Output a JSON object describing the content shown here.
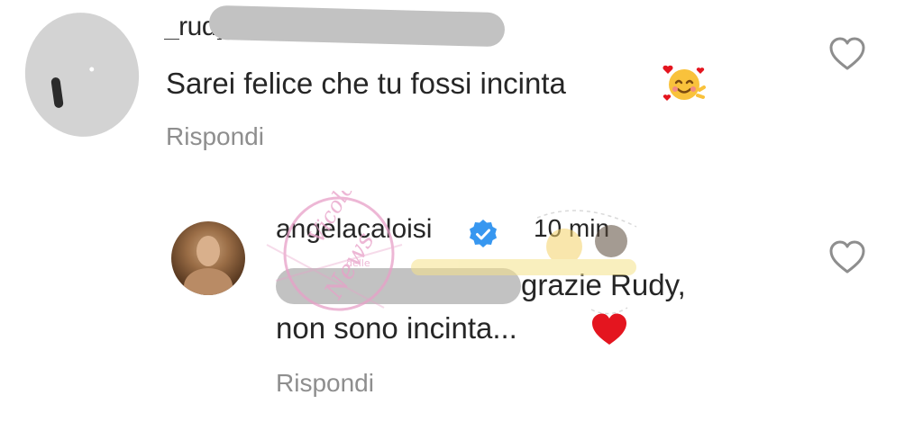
{
  "comments": [
    {
      "username": "_rudy_g",
      "text": "Sarei felice che tu fossi incinta",
      "emoji": "smiling-face-with-hearts",
      "reply_label": "Rispondi",
      "like_icon": "heart-outline-icon"
    },
    {
      "username": "angelacaloisi",
      "verified": true,
      "time": "10 min",
      "text_line1": "grazie Rudy,",
      "text_line2": "non sono incinta...",
      "emoji": "red-heart",
      "reply_label": "Rispondi",
      "like_icon": "heart-outline-icon"
    }
  ],
  "watermark": {
    "text_primary": "Vicolo",
    "text_secondary": "delle",
    "text_tertiary": "News"
  },
  "colors": {
    "text": "#262626",
    "muted": "#8e8e8e",
    "verified": "#3797f0",
    "heart_red": "#e4151f",
    "redaction": "#c2c2c2",
    "watermark_pink": "#e8a0c8"
  }
}
